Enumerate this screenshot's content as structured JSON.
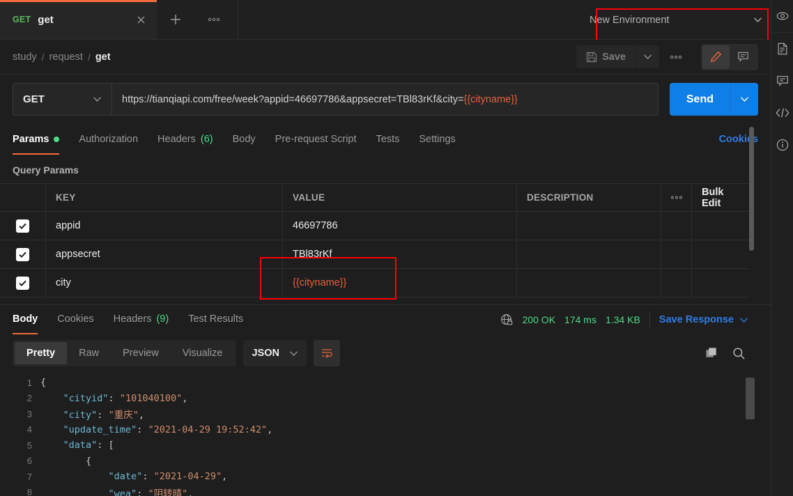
{
  "tabbar": {
    "tab": {
      "method": "GET",
      "title": "get",
      "close_icon": "close-icon"
    },
    "add_icon": "plus-icon",
    "more_icon": "ellipsis-icon"
  },
  "environment": {
    "selected": "New Environment",
    "caret_icon": "chevron-down-icon",
    "eye_icon": "eye-icon",
    "highlight_color": "#ff0000"
  },
  "breadcrumb": {
    "items": [
      "study",
      "request",
      "get"
    ],
    "separator": "/"
  },
  "header_actions": {
    "save_label": "Save",
    "save_icon": "floppy-disk-icon",
    "save_caret_icon": "chevron-down-icon",
    "more_icon": "ellipsis-icon",
    "edit_icon": "pencil-icon",
    "comment_icon": "comment-icon"
  },
  "url_bar": {
    "method": "GET",
    "method_caret_icon": "chevron-down-icon",
    "url_static": "https://tianqiapi.com/free/week?appid=46697786&appsecret=TBl83rKf&city=",
    "url_variable": "{{cityname}}",
    "send_label": "Send",
    "send_caret_icon": "chevron-down-icon",
    "send_color": "#0f7fe8"
  },
  "request_tabs": {
    "items": [
      {
        "label": "Params",
        "active": true,
        "dot": true
      },
      {
        "label": "Authorization",
        "active": false
      },
      {
        "label": "Headers",
        "active": false,
        "count": "(6)"
      },
      {
        "label": "Body",
        "active": false
      },
      {
        "label": "Pre-request Script",
        "active": false
      },
      {
        "label": "Tests",
        "active": false
      },
      {
        "label": "Settings",
        "active": false
      }
    ],
    "cookies_link": "Cookies"
  },
  "query_params": {
    "section_title": "Query Params",
    "columns": [
      "KEY",
      "VALUE",
      "DESCRIPTION"
    ],
    "more_icon": "ellipsis-icon",
    "bulk_edit_label": "Bulk Edit",
    "rows": [
      {
        "checked": true,
        "key": "appid",
        "value": "46697786",
        "description": "",
        "is_variable": false
      },
      {
        "checked": true,
        "key": "appsecret",
        "value": "TBl83rKf",
        "description": "",
        "is_variable": false
      },
      {
        "checked": true,
        "key": "city",
        "value": "{{cityname}}",
        "description": "",
        "is_variable": true
      }
    ],
    "highlight_color": "#ff0000"
  },
  "response": {
    "tabs": [
      {
        "label": "Body",
        "active": true
      },
      {
        "label": "Cookies",
        "active": false
      },
      {
        "label": "Headers",
        "active": false,
        "count": "(9)"
      },
      {
        "label": "Test Results",
        "active": false
      }
    ],
    "status_icon": "globe-lock-icon",
    "status": "200 OK",
    "time": "174 ms",
    "size": "1.34 KB",
    "save_response_label": "Save Response",
    "save_response_caret_icon": "chevron-down-icon",
    "status_color": "#4ddb8b"
  },
  "response_format": {
    "views": [
      {
        "label": "Pretty",
        "active": true
      },
      {
        "label": "Raw",
        "active": false
      },
      {
        "label": "Preview",
        "active": false
      },
      {
        "label": "Visualize",
        "active": false
      }
    ],
    "language": "JSON",
    "language_caret_icon": "chevron-down-icon",
    "wrap_icon": "word-wrap-icon",
    "copy_icon": "copy-icon",
    "search_icon": "search-icon"
  },
  "response_body": {
    "lines": [
      {
        "no": "1",
        "segments": [
          {
            "t": "{",
            "c": "p"
          }
        ]
      },
      {
        "no": "2",
        "segments": [
          {
            "t": "    ",
            "c": "p"
          },
          {
            "t": "\"cityid\"",
            "c": "k"
          },
          {
            "t": ": ",
            "c": "p"
          },
          {
            "t": "\"101040100\"",
            "c": "s"
          },
          {
            "t": ",",
            "c": "p"
          }
        ]
      },
      {
        "no": "3",
        "segments": [
          {
            "t": "    ",
            "c": "p"
          },
          {
            "t": "\"city\"",
            "c": "k"
          },
          {
            "t": ": ",
            "c": "p"
          },
          {
            "t": "\"重庆\"",
            "c": "s"
          },
          {
            "t": ",",
            "c": "p"
          }
        ]
      },
      {
        "no": "4",
        "segments": [
          {
            "t": "    ",
            "c": "p"
          },
          {
            "t": "\"update_time\"",
            "c": "k"
          },
          {
            "t": ": ",
            "c": "p"
          },
          {
            "t": "\"2021-04-29 19:52:42\"",
            "c": "s"
          },
          {
            "t": ",",
            "c": "p"
          }
        ]
      },
      {
        "no": "5",
        "segments": [
          {
            "t": "    ",
            "c": "p"
          },
          {
            "t": "\"data\"",
            "c": "k"
          },
          {
            "t": ": [",
            "c": "p"
          }
        ]
      },
      {
        "no": "6",
        "segments": [
          {
            "t": "        {",
            "c": "p"
          }
        ]
      },
      {
        "no": "7",
        "segments": [
          {
            "t": "            ",
            "c": "p"
          },
          {
            "t": "\"date\"",
            "c": "k"
          },
          {
            "t": ": ",
            "c": "p"
          },
          {
            "t": "\"2021-04-29\"",
            "c": "s"
          },
          {
            "t": ",",
            "c": "p"
          }
        ]
      },
      {
        "no": "8",
        "segments": [
          {
            "t": "            ",
            "c": "p"
          },
          {
            "t": "\"wea\"",
            "c": "k"
          },
          {
            "t": ": ",
            "c": "p"
          },
          {
            "t": "\"阴转晴\"",
            "c": "s"
          },
          {
            "t": ",",
            "c": "p"
          }
        ]
      }
    ]
  },
  "right_rail": {
    "items": [
      {
        "icon": "eye-icon",
        "name": "environment-quick-look"
      },
      {
        "icon": "document-icon",
        "name": "documentation"
      },
      {
        "icon": "comment-icon",
        "name": "comments"
      },
      {
        "icon": "code-icon",
        "name": "code-snippet"
      },
      {
        "icon": "info-icon",
        "name": "info"
      }
    ]
  }
}
